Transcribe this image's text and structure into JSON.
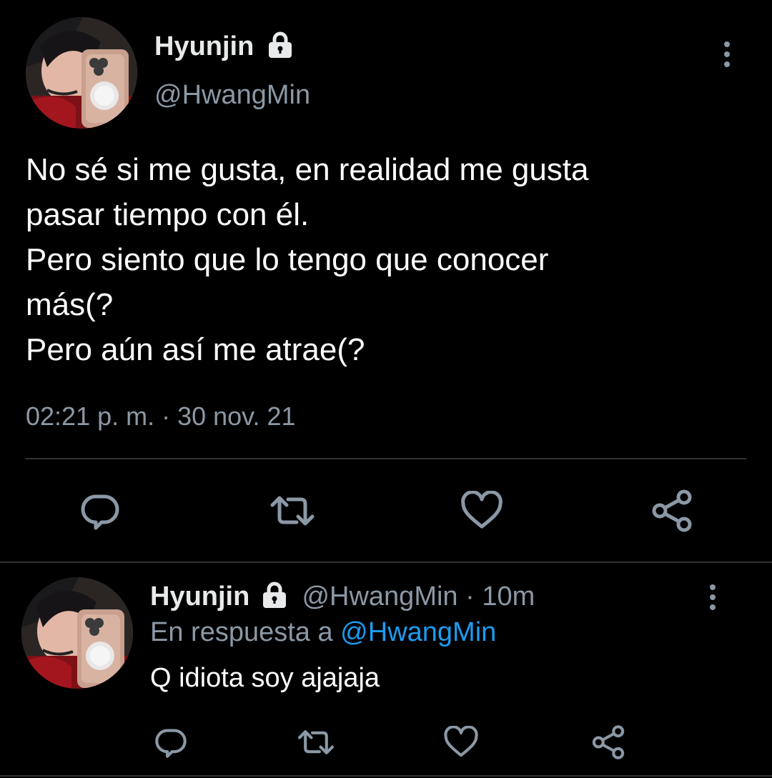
{
  "main_tweet": {
    "display_name": "Hyunjin",
    "handle": "@HwangMin",
    "text": "No sé si me gusta, en realidad me gusta\npasar tiempo con él.\nPero siento que lo tengo que conocer\nmás(?\nPero aún así me atrae(?",
    "timestamp": "02:21 p. m. · 30 nov. 21"
  },
  "reply_tweet": {
    "display_name": "Hyunjin",
    "handle_time": "@HwangMin · 10m",
    "reply_prefix": "En respuesta a ",
    "reply_to": "@HwangMin",
    "text": "Q idiota soy ajajaja"
  },
  "icons": {
    "lock": "lock-icon",
    "more": "more-vertical-icon",
    "reply": "reply-icon",
    "retweet": "retweet-icon",
    "like": "heart-icon",
    "share": "share-icon"
  },
  "colors": {
    "background": "#000000",
    "text": "#ffffff",
    "secondary": "#8b98a5",
    "link": "#1d9bf0",
    "divider": "#2f3336"
  }
}
